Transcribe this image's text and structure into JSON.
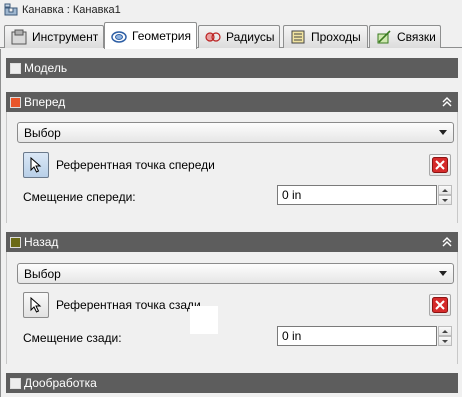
{
  "window": {
    "title": "Канавка : Канавка1"
  },
  "tabs": [
    {
      "label": "Инструмент",
      "icon": "tool-icon",
      "active": false
    },
    {
      "label": "Геометрия",
      "icon": "geometry-icon",
      "active": true
    },
    {
      "label": "Радиусы",
      "icon": "radii-icon",
      "active": false
    },
    {
      "label": "Проходы",
      "icon": "passes-icon",
      "active": false
    },
    {
      "label": "Связки",
      "icon": "links-icon",
      "active": false
    }
  ],
  "sections": {
    "model": {
      "label": "Модель"
    },
    "front": {
      "label": "Вперед",
      "color": "#e8552a",
      "select_value": "Выбор",
      "ref_point_label": "Референтная точка спереди",
      "offset_label": "Смещение спереди:",
      "offset_value": "0 in"
    },
    "back": {
      "label": "Назад",
      "color": "#6b6a16",
      "select_value": "Выбор",
      "ref_point_label": "Референтная точка сзади",
      "offset_label": "Смещение сзади:",
      "offset_value": "0 in"
    },
    "refinement": {
      "label": "Дообработка"
    }
  },
  "colors": {
    "section_header": "#5d5d5d",
    "panel_bg": "#f0f0f0",
    "delete_red": "#d62b2b"
  }
}
